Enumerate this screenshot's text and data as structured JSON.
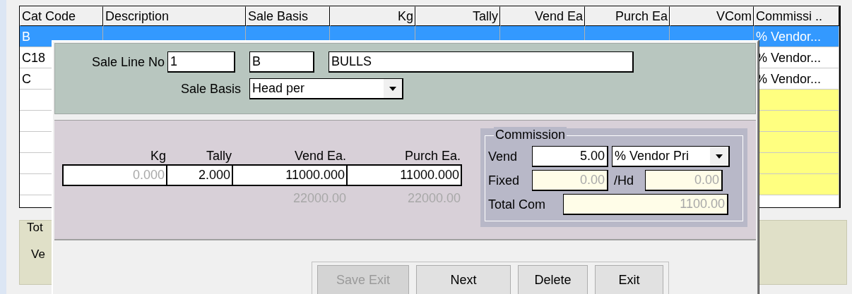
{
  "grid": {
    "columns": [
      {
        "label": "Cat Code",
        "kind": "text"
      },
      {
        "label": "Description",
        "kind": "text"
      },
      {
        "label": "Sale Basis",
        "kind": "text"
      },
      {
        "label": "Kg",
        "kind": "number"
      },
      {
        "label": "Tally",
        "kind": "number"
      },
      {
        "label": "Vend Ea",
        "kind": "number"
      },
      {
        "label": "Purch Ea",
        "kind": "number"
      },
      {
        "label": "VCom",
        "kind": "number"
      },
      {
        "label": "Commissi ..",
        "kind": "text"
      }
    ],
    "rows": [
      {
        "kind": "data",
        "selected": true,
        "cat_code": "B",
        "commission": "% Vendor..."
      },
      {
        "kind": "data",
        "selected": false,
        "cat_code": "C18",
        "commission": "% Vendor..."
      },
      {
        "kind": "data",
        "selected": false,
        "cat_code": "C",
        "commission": "% Vendor..."
      },
      {
        "kind": "new",
        "selected": false
      },
      {
        "kind": "new",
        "selected": false
      },
      {
        "kind": "new",
        "selected": false
      },
      {
        "kind": "new",
        "selected": false
      },
      {
        "kind": "new",
        "selected": false
      },
      {
        "kind": "blank",
        "selected": false
      }
    ]
  },
  "totals_group": {
    "title": "Tot",
    "label": "Ve"
  },
  "dialog": {
    "sale_line_label": "Sale Line No",
    "sale_line_no": "1",
    "cat_code": "B",
    "description": "BULLS",
    "sale_basis_label": "Sale Basis",
    "sale_basis": "Head per",
    "amounts": [
      {
        "label": "Kg",
        "value": "0.000",
        "disabled": true
      },
      {
        "label": "Tally",
        "value": "2.000",
        "disabled": false
      },
      {
        "label": "Vend Ea.",
        "value": "11000.000",
        "disabled": false,
        "total": "22000.00"
      },
      {
        "label": "Purch Ea.",
        "value": "11000.000",
        "disabled": false,
        "total": "22000.00"
      }
    ],
    "commission": {
      "title": "Commission",
      "vend_label": "Vend",
      "vend": "5.00",
      "vend_basis": "% Vendor Pri",
      "fixed_label": "Fixed",
      "fixed": "0.00",
      "per_head_label": "/Hd",
      "per_head": "0.00",
      "total_label": "Total Com",
      "total": "1100.00"
    },
    "buttons": [
      {
        "label": "Save  Exit",
        "disabled": true
      },
      {
        "label": "Next",
        "disabled": false
      },
      {
        "label": "Delete",
        "disabled": false
      },
      {
        "label": "Exit",
        "disabled": false
      }
    ]
  }
}
